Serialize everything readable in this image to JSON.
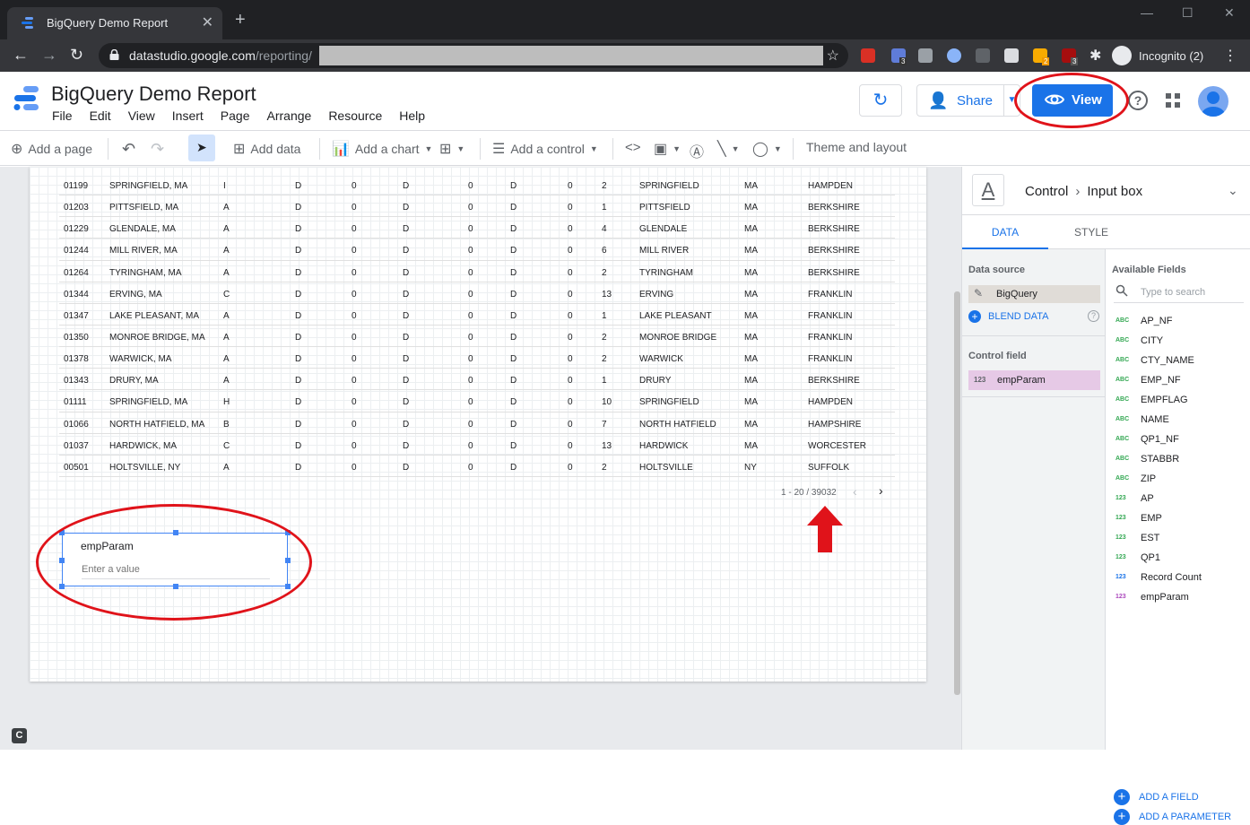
{
  "browser": {
    "tab_title": "BigQuery Demo Report",
    "url_domain": "datastudio.google.com",
    "url_path": "/reporting/",
    "incognito_label": "Incognito (2)",
    "ext_badges": [
      "3",
      "2",
      "3"
    ]
  },
  "report": {
    "title": "BigQuery Demo Report",
    "menu": [
      "File",
      "Edit",
      "View",
      "Insert",
      "Page",
      "Arrange",
      "Resource",
      "Help"
    ],
    "share_label": "Share",
    "view_label": "View"
  },
  "toolbar": {
    "add_page": "Add a page",
    "add_data": "Add data",
    "add_chart": "Add a chart",
    "add_control": "Add a control",
    "theme": "Theme and layout"
  },
  "table": {
    "rows": [
      [
        "01199",
        "SPRINGFIELD, MA",
        "I",
        "D",
        "0",
        "D",
        "0",
        "D",
        "0",
        "2",
        "SPRINGFIELD",
        "MA",
        "HAMPDEN"
      ],
      [
        "01203",
        "PITTSFIELD, MA",
        "A",
        "D",
        "0",
        "D",
        "0",
        "D",
        "0",
        "1",
        "PITTSFIELD",
        "MA",
        "BERKSHIRE"
      ],
      [
        "01229",
        "GLENDALE, MA",
        "A",
        "D",
        "0",
        "D",
        "0",
        "D",
        "0",
        "4",
        "GLENDALE",
        "MA",
        "BERKSHIRE"
      ],
      [
        "01244",
        "MILL RIVER, MA",
        "A",
        "D",
        "0",
        "D",
        "0",
        "D",
        "0",
        "6",
        "MILL RIVER",
        "MA",
        "BERKSHIRE"
      ],
      [
        "01264",
        "TYRINGHAM, MA",
        "A",
        "D",
        "0",
        "D",
        "0",
        "D",
        "0",
        "2",
        "TYRINGHAM",
        "MA",
        "BERKSHIRE"
      ],
      [
        "01344",
        "ERVING, MA",
        "C",
        "D",
        "0",
        "D",
        "0",
        "D",
        "0",
        "13",
        "ERVING",
        "MA",
        "FRANKLIN"
      ],
      [
        "01347",
        "LAKE PLEASANT, MA",
        "A",
        "D",
        "0",
        "D",
        "0",
        "D",
        "0",
        "1",
        "LAKE PLEASANT",
        "MA",
        "FRANKLIN"
      ],
      [
        "01350",
        "MONROE BRIDGE, MA",
        "A",
        "D",
        "0",
        "D",
        "0",
        "D",
        "0",
        "2",
        "MONROE BRIDGE",
        "MA",
        "FRANKLIN"
      ],
      [
        "01378",
        "WARWICK, MA",
        "A",
        "D",
        "0",
        "D",
        "0",
        "D",
        "0",
        "2",
        "WARWICK",
        "MA",
        "FRANKLIN"
      ],
      [
        "01343",
        "DRURY, MA",
        "A",
        "D",
        "0",
        "D",
        "0",
        "D",
        "0",
        "1",
        "DRURY",
        "MA",
        "BERKSHIRE"
      ],
      [
        "01111",
        "SPRINGFIELD, MA",
        "H",
        "D",
        "0",
        "D",
        "0",
        "D",
        "0",
        "10",
        "SPRINGFIELD",
        "MA",
        "HAMPDEN"
      ],
      [
        "01066",
        "NORTH HATFIELD, MA",
        "B",
        "D",
        "0",
        "D",
        "0",
        "D",
        "0",
        "7",
        "NORTH HATFIELD",
        "MA",
        "HAMPSHIRE"
      ],
      [
        "01037",
        "HARDWICK, MA",
        "C",
        "D",
        "0",
        "D",
        "0",
        "D",
        "0",
        "13",
        "HARDWICK",
        "MA",
        "WORCESTER"
      ],
      [
        "00501",
        "HOLTSVILLE, NY",
        "A",
        "D",
        "0",
        "D",
        "0",
        "D",
        "0",
        "2",
        "HOLTSVILLE",
        "NY",
        "SUFFOLK"
      ]
    ],
    "pager": "1 - 20 / 39032"
  },
  "input_control": {
    "label": "empParam",
    "placeholder": "Enter a value"
  },
  "panel": {
    "crumb_parent": "Control",
    "crumb_child": "Input box",
    "tab_data": "DATA",
    "tab_style": "STYLE",
    "data_source_label": "Data source",
    "data_source": "BigQuery",
    "blend_data": "BLEND DATA",
    "control_field_label": "Control field",
    "control_field": "empParam",
    "control_field_type": "123",
    "available_fields_label": "Available Fields",
    "search_placeholder": "Type to search",
    "fields": [
      {
        "type": "ABC",
        "name": "AP_NF",
        "kind": "dim"
      },
      {
        "type": "ABC",
        "name": "CITY",
        "kind": "dim"
      },
      {
        "type": "ABC",
        "name": "CTY_NAME",
        "kind": "dim"
      },
      {
        "type": "ABC",
        "name": "EMP_NF",
        "kind": "dim"
      },
      {
        "type": "ABC",
        "name": "EMPFLAG",
        "kind": "dim"
      },
      {
        "type": "ABC",
        "name": "NAME",
        "kind": "dim"
      },
      {
        "type": "ABC",
        "name": "QP1_NF",
        "kind": "dim"
      },
      {
        "type": "ABC",
        "name": "STABBR",
        "kind": "dim"
      },
      {
        "type": "ABC",
        "name": "ZIP",
        "kind": "dim"
      },
      {
        "type": "123",
        "name": "AP",
        "kind": "met"
      },
      {
        "type": "123",
        "name": "EMP",
        "kind": "met"
      },
      {
        "type": "123",
        "name": "EST",
        "kind": "met"
      },
      {
        "type": "123",
        "name": "QP1",
        "kind": "met"
      },
      {
        "type": "123",
        "name": "Record Count",
        "kind": "rec"
      },
      {
        "type": "123",
        "name": "empParam",
        "kind": "param"
      }
    ],
    "add_field": "ADD A FIELD",
    "add_parameter": "ADD A PARAMETER"
  },
  "colors": {
    "accent": "#1a73e8",
    "dimension": "#34a853",
    "metric": "#34a853",
    "record_count": "#1a73e8",
    "parameter": "#ab47bc",
    "annotation": "#e0131a"
  },
  "corner_icon": "C"
}
